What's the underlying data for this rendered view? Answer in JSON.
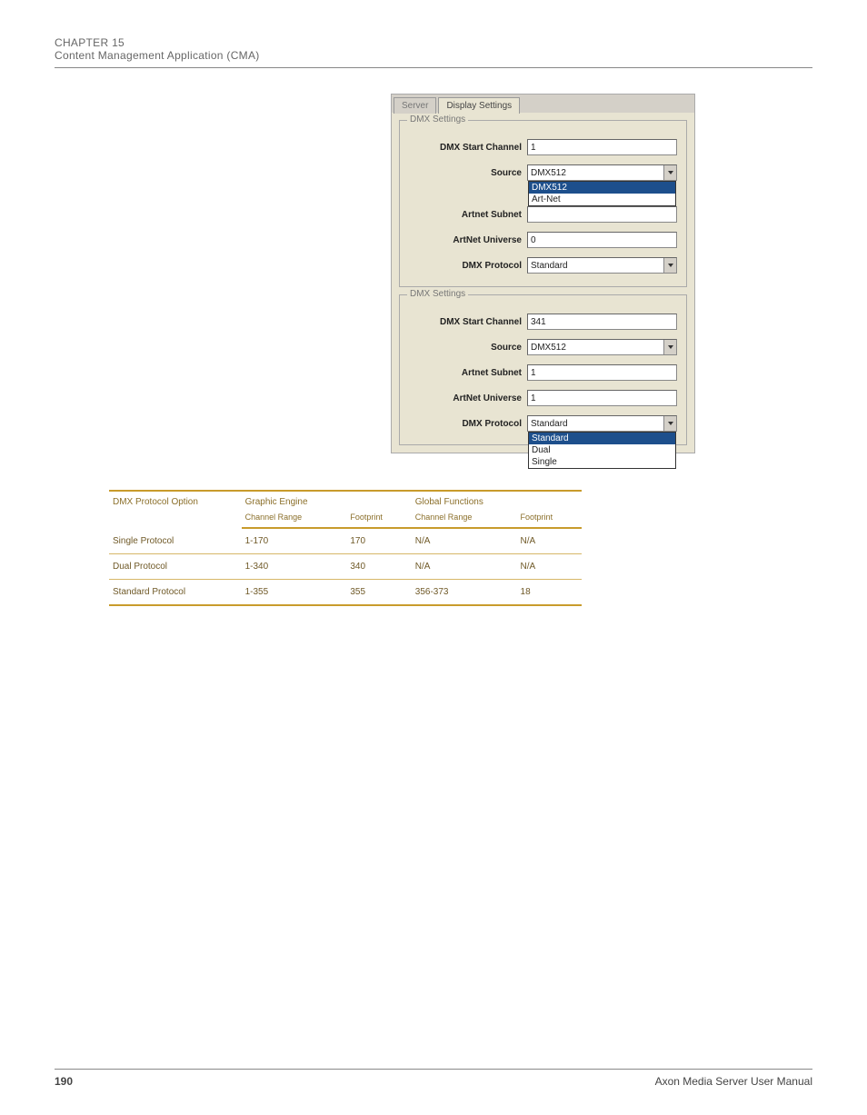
{
  "header": {
    "chapter": "CHAPTER 15",
    "title": "Content Management Application (CMA)"
  },
  "screenshot": {
    "tabs": {
      "server": "Server",
      "display": "Display Settings"
    },
    "legend": "DMX Settings",
    "f1": {
      "start_channel_label": "DMX Start Channel",
      "start_channel_value": "1",
      "source_label": "Source",
      "source_value": "DMX512",
      "source_options": [
        "DMX512",
        "Art-Net"
      ],
      "artnet_subnet_label": "Artnet Subnet",
      "artnet_subnet_value": "",
      "artnet_universe_label": "ArtNet Universe",
      "artnet_universe_value": "0",
      "dmx_protocol_label": "DMX Protocol",
      "dmx_protocol_value": "Standard"
    },
    "f2": {
      "start_channel_label": "DMX Start Channel",
      "start_channel_value": "341",
      "source_label": "Source",
      "source_value": "DMX512",
      "artnet_subnet_label": "Artnet Subnet",
      "artnet_subnet_value": "1",
      "artnet_universe_label": "ArtNet Universe",
      "artnet_universe_value": "1",
      "dmx_protocol_label": "DMX Protocol",
      "dmx_protocol_value": "Standard",
      "dmx_protocol_options": [
        "Standard",
        "Dual",
        "Single"
      ]
    }
  },
  "table": {
    "head": {
      "protocol": "DMX Protocol Option",
      "graphic": "Graphic Engine",
      "global": "Global Functions",
      "subA": "Channel Range",
      "subB": "Footprint",
      "subC": "Channel Range",
      "subD": "Footprint"
    },
    "rows": [
      {
        "protocol": "Single Protocol",
        "a": "1-170",
        "b": "170",
        "c": "N/A",
        "d": "N/A"
      },
      {
        "protocol": "Dual Protocol",
        "a": "1-340",
        "b": "340",
        "c": "N/A",
        "d": "N/A"
      },
      {
        "protocol": "Standard Protocol",
        "a": "1-355",
        "b": "355",
        "c": "356-373",
        "d": "18"
      }
    ]
  },
  "footer": {
    "page": "190",
    "manual": "Axon Media Server User Manual"
  }
}
